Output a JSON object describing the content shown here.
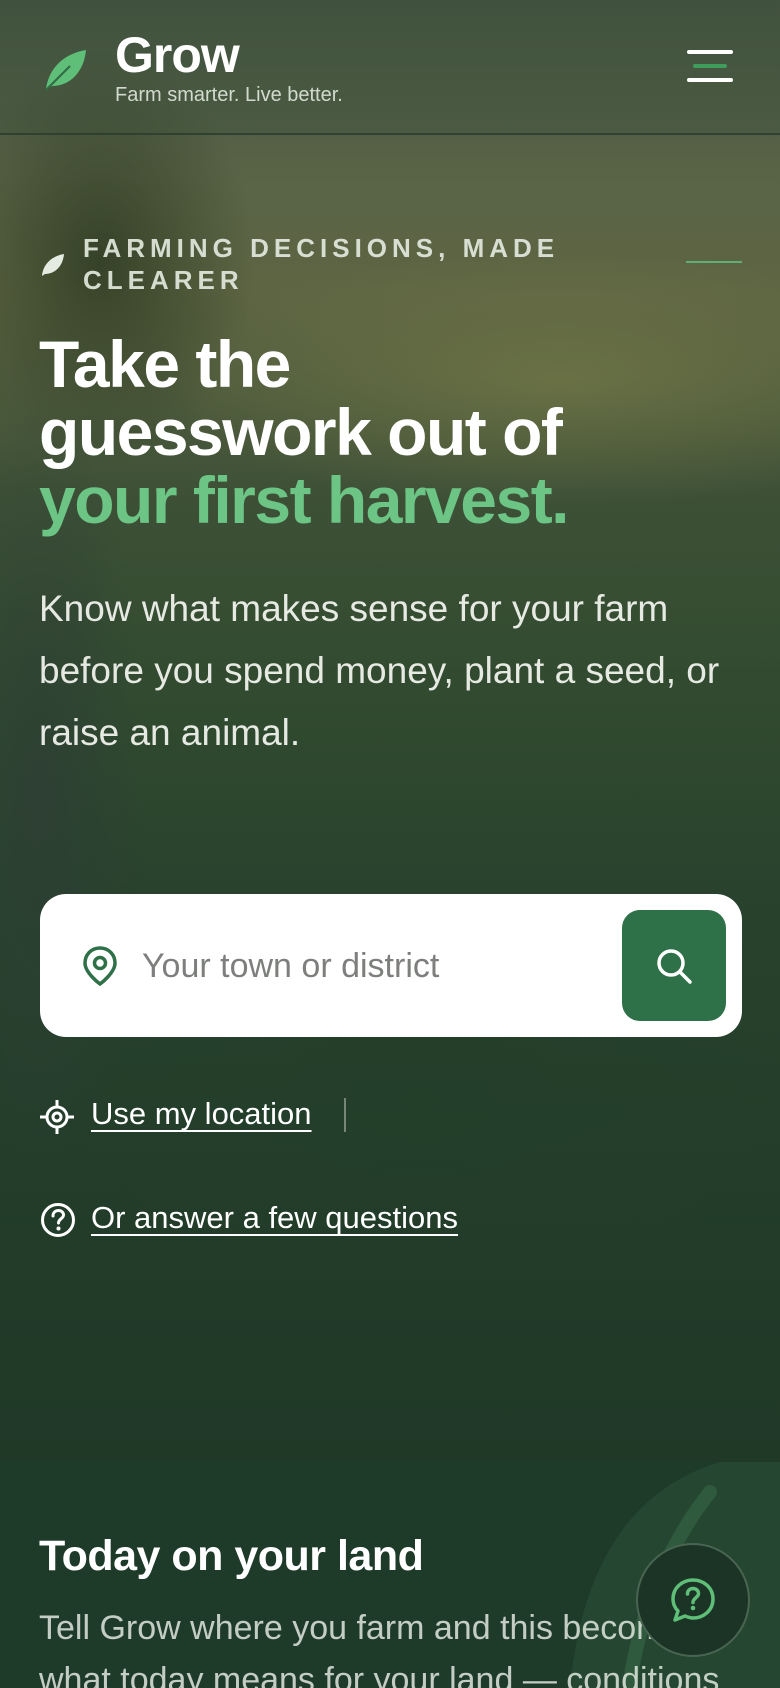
{
  "header": {
    "brand_name": "Grow",
    "tagline": "Farm smarter. Live better.",
    "menu_icon": "hamburger-menu-icon"
  },
  "hero": {
    "eyebrow": "FARMING DECISIONS, MADE CLEARER",
    "headline_line1": "Take the",
    "headline_line2": "guesswork out of",
    "headline_accent": "your first harvest.",
    "lede": "Know what makes sense for your farm before you spend money, plant a seed, or raise an animal."
  },
  "search": {
    "placeholder": "Your town or district",
    "value": "",
    "pin_icon": "map-pin-icon",
    "button_icon": "search-icon"
  },
  "actions": {
    "use_location": "Use my location",
    "answer_questions": "Or answer a few questions"
  },
  "today": {
    "title": "Today on your land",
    "body": "Tell Grow where you farm and this becomes what today means for your land — conditions"
  },
  "fab": {
    "icon": "chat-help-icon"
  },
  "colors": {
    "accent_green": "#6cc485",
    "button_green": "#2e7048",
    "section_dark": "#1e3a29"
  }
}
